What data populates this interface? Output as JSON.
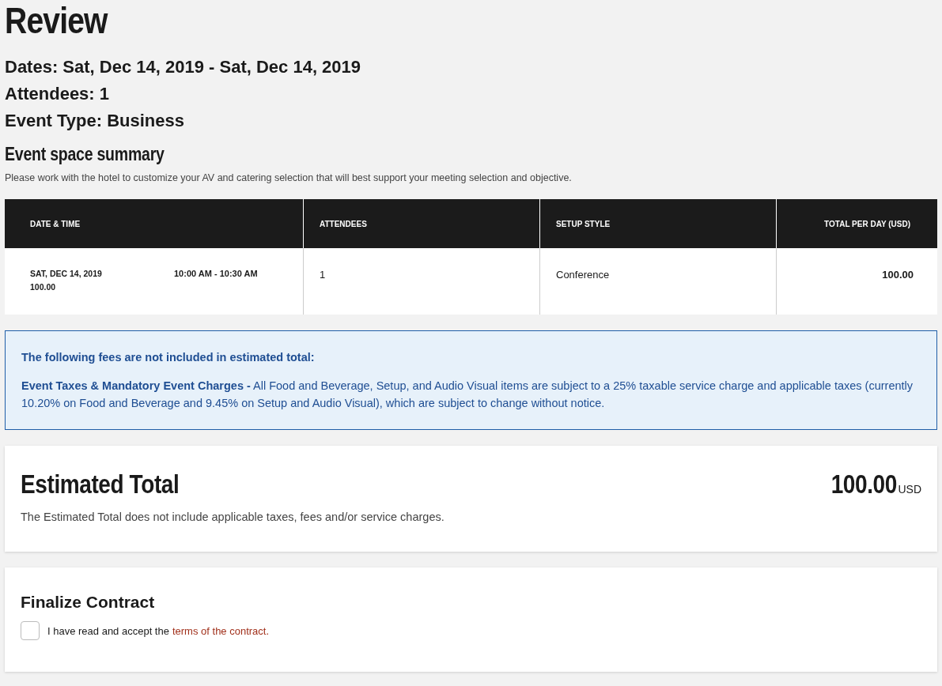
{
  "title": "Review",
  "details": [
    {
      "label": "Dates:",
      "value": "Sat, Dec 14, 2019 - Sat, Dec 14, 2019"
    },
    {
      "label": "Attendees:",
      "value": "1"
    },
    {
      "label": "Event Type:",
      "value": "Business"
    }
  ],
  "summary": {
    "heading": "Event space summary",
    "note": "Please work with the hotel to customize your AV and catering selection that will best support your meeting selection and objective."
  },
  "table": {
    "columns": [
      "DATE & TIME",
      "ATTENDEES",
      "SETUP STYLE",
      "TOTAL PER DAY (USD)"
    ],
    "rows": [
      {
        "date": "SAT, DEC 14, 2019",
        "time": "10:00 AM - 10:30 AM",
        "price": "100.00",
        "attendees": "1",
        "setup": "Conference",
        "total": "100.00"
      }
    ]
  },
  "fees": {
    "heading": "The following fees are not included in estimated total:",
    "text": "**Event Taxes & Mandatory Event Charges -** All Food and Beverage, Setup, and Audio Visual items are subject to a 25% taxable service charge and applicable taxes (currently 10.20% on Food and Beverage and 9.45% on Setup and Audio Visual), which are subject to change without notice."
  },
  "estimate": {
    "heading": "Estimated Total",
    "amount": "100.00",
    "currency": "USD",
    "note": "The Estimated Total does not include applicable taxes, fees and/or service charges."
  },
  "contract": {
    "heading": "Finalize Contract",
    "checked": false,
    "label": "I have read and accept the",
    "link": "terms of the contract."
  }
}
